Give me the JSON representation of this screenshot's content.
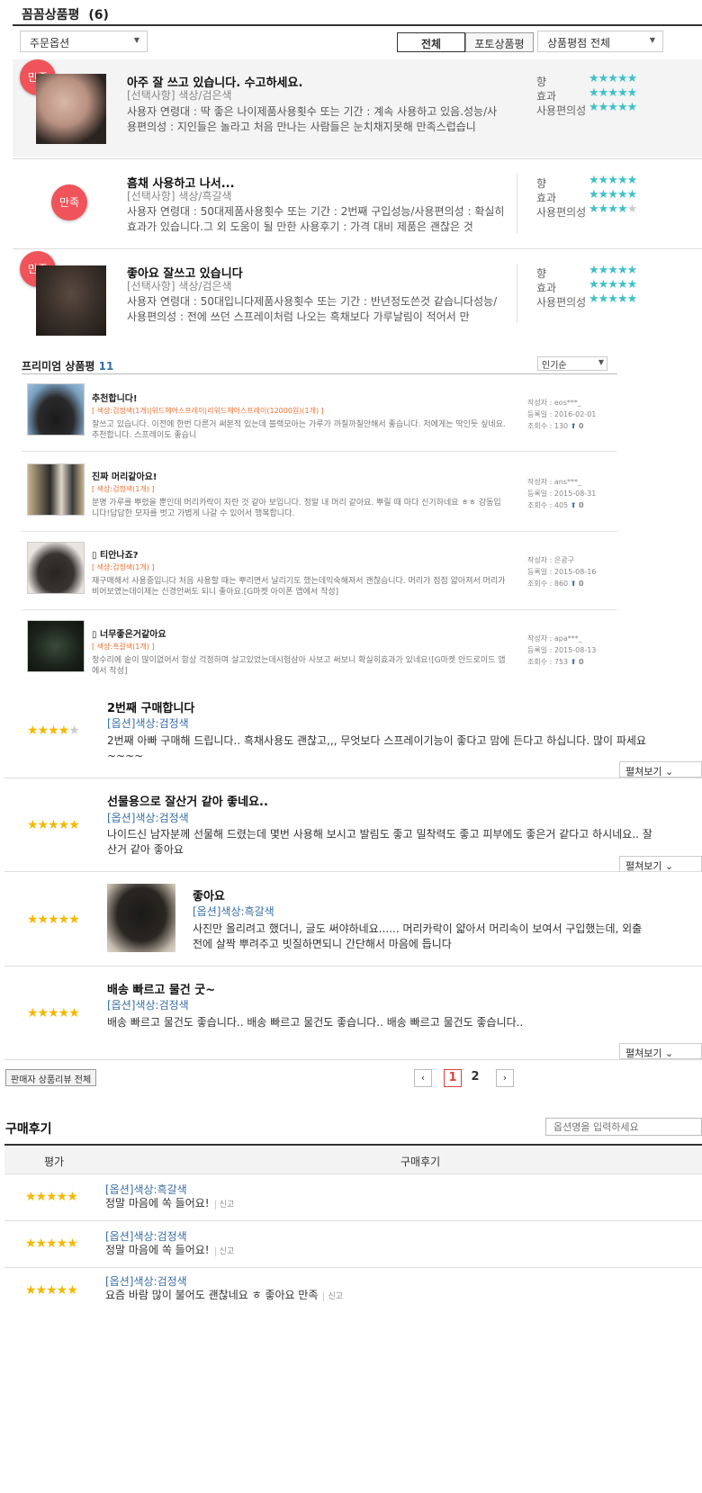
{
  "header": {
    "title": "꼼꼼상품평",
    "count": "(6)"
  },
  "filters": {
    "order_option": "주문옵션",
    "tab_all": "전체",
    "tab_photo": "포토상품평",
    "rating_filter": "상품평점 전체"
  },
  "criteria": [
    "향",
    "효과",
    "사용편의성"
  ],
  "detailed_reviews": [
    {
      "badge": "만족",
      "title": "아주 잘 쓰고 있습니다. 수고하세요.",
      "option": "[선택사항] 색상/검은색",
      "body": "사용자 연령대 : 딱 좋은 나이제품사용횟수 또는 기간 : 계속 사용하고 있음.성능/사용편의성 : 지인들은 놀라고 처음 만나는 사람들은 눈치채지못해 만족스럽습니",
      "ratings": [
        5,
        5,
        5
      ]
    },
    {
      "badge": "만족",
      "title": "흠채 사용하고 나서...",
      "option": "[선택사항] 색상/흑갈색",
      "body": "사용자 연령대 : 50대제품사용횟수 또는 기간 : 2번째 구입성능/사용편의성 : 확실히 효과가 있습니다.그 외 도움이 될 만한 사용후기 : 가격 대비 제품은 괜찮은 것",
      "ratings": [
        5,
        5,
        4
      ]
    },
    {
      "badge": "만족",
      "title": "좋아요 잘쓰고 있습니다",
      "option": "[선택사항] 색상/검은색",
      "body": "사용자 연령대 : 50대입니다제품사용횟수 또는 기간 : 반년정도쓴것 같습니다성능/사용편의성 : 전에 쓰던 스프레이처럼 나오는 흑채보다 가루날림이 적어서 만",
      "ratings": [
        5,
        5,
        5
      ]
    }
  ],
  "premium": {
    "title": "프리미엄 상품평",
    "count": "11",
    "sort": "인기순",
    "labels": {
      "author": "작성자 : ",
      "date": "등록일 : ",
      "views": "조회수 : "
    },
    "items": [
      {
        "title": "추천합니다!",
        "option": "[ 색상:검정색(1개)|위드헤어스프레이|리위드헤어스프레이(12000원)(1개) ]",
        "body": "잘쓰고 있습니다. 이전에 한번 다른거 써본적 있는데 블랙모아는 가루가 까칠까칠안해서 좋습니다. 저에게는 딱인듯 싶네요. 추천합니다. 스프레이도 좋습니",
        "author": "eos***_",
        "date": "2016-02-01",
        "views": "130"
      },
      {
        "title": "진짜 머리같아요!",
        "option": "[ 색상:검정색(1개) ]",
        "body": "분명 가루를 뿌렸을 뿐인데 머리카락이 자란 것 같아 보입니다. 정말 내 머리 같아요. 뿌릴 때 마다 신기하네요 ㅎㅎ 감동입니다!답답한 모자를 벗고 가볍게 나갈 수 있어서 행복합니다.",
        "author": "ans***_",
        "date": "2015-08-31",
        "views": "405"
      },
      {
        "title": "티안나죠?",
        "option": "[ 색상:검정색(1개) ]",
        "body": "재구매해서 사용중입니다 처음 사용할 때는 뿌리면서 날리기도 했는데익숙해져서 괜찮습니다. 머리가 점점 얇아져서 머리가 비어보였는데이제는 신경안써도 되니 좋아요.[G마켓 아이폰 앱에서 작성]",
        "author": "은광구",
        "date": "2015-08-16",
        "views": "860"
      },
      {
        "title": "너무좋은거같아요",
        "option": "[ 색상:흑갈색(1개) ]",
        "body": "정수리에 숱이 많이없어서 항상 걱정하며 살고있었는데시험삼아 사보고 써보니 확실히효과가 있네요![G마켓 안드로이드 앱에서 작성]",
        "author": "apa***_",
        "date": "2015-08-13",
        "views": "753"
      }
    ]
  },
  "reviews": [
    {
      "stars": 4,
      "title": "2번째 구매합니다",
      "option": "[옵션]색상:검정색",
      "body": "2번째 아빠 구매해 드립니다.. 흑채사용도 괜찮고,,, 무엇보다 스프레이기능이 좋다고 맘에 든다고 하십니다. 많이 파세요 ~~~~",
      "more": "펼쳐보기"
    },
    {
      "stars": 5,
      "title": "선물용으로 잘산거 같아 좋네요..",
      "option": "[옵션]색상:검정색",
      "body": "나이드신 남자분께 선물해 드렸는데 몇번 사용해 보시고 발림도 좋고 밀착력도 좋고 피부에도 좋은거 같다고 하시네요.. 잘 산거 같아 좋아요",
      "more": "펼쳐보기"
    },
    {
      "stars": 5,
      "title": "좋아요",
      "option": "[옵션]색상:흑갈색",
      "body": "사진만 올리려고 했더니, 글도 써야하네요...... 머리카락이 얇아서 머리속이 보여서 구입했는데, 외출 전에 살짝 뿌려주고 빗질하면되니 간단해서 마음에 듭니다",
      "more": ""
    },
    {
      "stars": 5,
      "title": "배송 빠르고 물건 굿~",
      "option": "[옵션]색상:검정색",
      "body": "배송 빠르고 물건도 좋습니다.. 배송 빠르고 물건도 좋습니다.. 배송 빠르고 물건도 좋습니다..",
      "more": "펼쳐보기"
    }
  ],
  "seller_all": "판매자 상품리뷰 전체",
  "pagination": {
    "prev": "‹",
    "pages": [
      "1",
      "2"
    ],
    "next": "›",
    "current": "1"
  },
  "purchase": {
    "title": "구매후기",
    "search_placeholder": "옵션명을 입력하세요",
    "col_rating": "평가",
    "col_review": "구매후기",
    "report": "신고",
    "items": [
      {
        "stars": 5,
        "option": "[옵션]색상:흑갈색",
        "text": "정말 마음에 쏙 들어요!"
      },
      {
        "stars": 5,
        "option": "[옵션]색상:검정색",
        "text": "정말 마음에 쏙 들어요!"
      },
      {
        "stars": 5,
        "option": "[옵션]색상:검정색",
        "text": "요즘 바람 많이 불어도 괜찮네요 ㅎ 좋아요 만족"
      }
    ]
  },
  "colors": {
    "badge": "#f0545a",
    "teal_star": "#3ec1c9",
    "yellow_star": "#f5b800",
    "link": "#3a6ea5"
  }
}
